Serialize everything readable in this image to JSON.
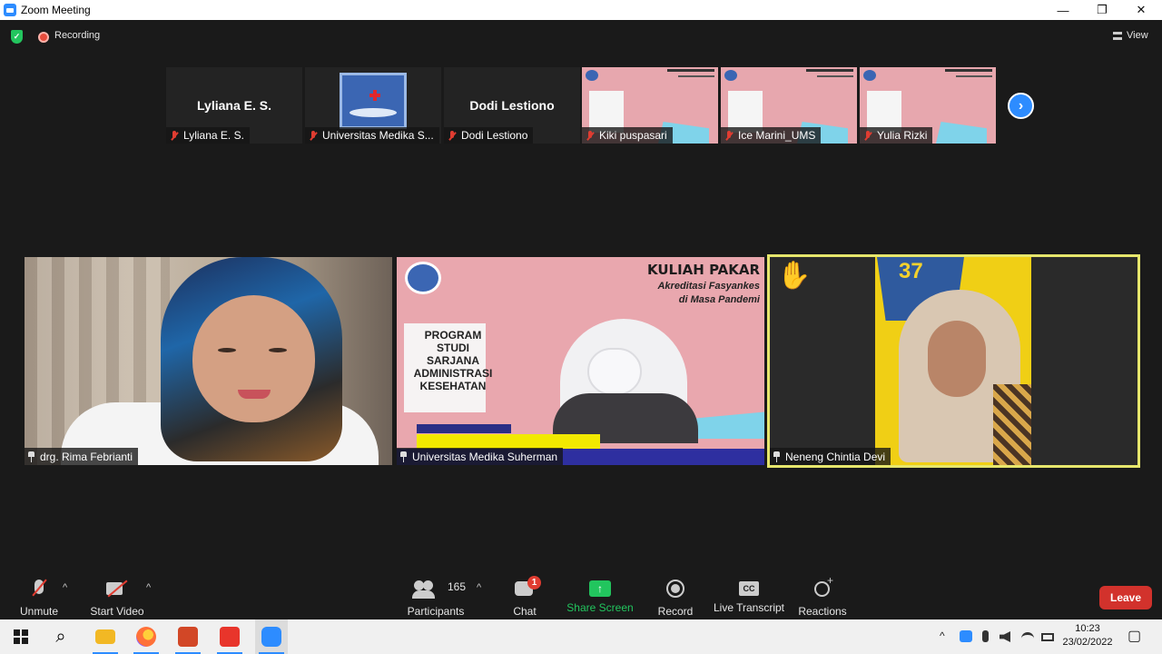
{
  "window": {
    "title": "Zoom Meeting",
    "minimize": "—",
    "restore": "❐",
    "close": "✕"
  },
  "topbar": {
    "security_mark": "✓",
    "recording_label": "Recording",
    "view_label": "View"
  },
  "thumbnails": [
    {
      "display_name": "Lyliana E. S.",
      "label": "Lyliana E. S.",
      "muted": true,
      "content": "name"
    },
    {
      "display_name": "",
      "label": "Universitas Medika S...",
      "muted": true,
      "content": "logo"
    },
    {
      "display_name": "Dodi Lestiono",
      "label": "Dodi Lestiono",
      "muted": true,
      "content": "name"
    },
    {
      "display_name": "",
      "label": "Kiki puspasari",
      "muted": true,
      "content": "slide"
    },
    {
      "display_name": "",
      "label": "Ice Marini_UMS",
      "muted": true,
      "content": "slide"
    },
    {
      "display_name": "",
      "label": "Yulia Rizki",
      "muted": true,
      "content": "slide"
    }
  ],
  "next_page": "›",
  "tiles": [
    {
      "label": "drg. Rima Febrianti"
    },
    {
      "label": "Universitas Medika Suherman",
      "slide_title": "KULIAH PAKAR",
      "slide_subtitle_1": "Akreditasi Fasyankes",
      "slide_subtitle_2": "di Masa Pandemi",
      "program_lines": [
        "PROGRAM",
        "STUDI",
        "SARJANA",
        "ADMINISTRASI",
        "KESEHATAN"
      ]
    },
    {
      "label": "Neneng Chintia Devi",
      "hand_raised": "✋",
      "badge_text": "37"
    }
  ],
  "toolbar": {
    "unmute": "Unmute",
    "start_video": "Start Video",
    "participants": "Participants",
    "participants_count": "165",
    "chat": "Chat",
    "chat_badge": "1",
    "share_screen": "Share Screen",
    "share_arrow": "↑",
    "record": "Record",
    "live_transcript": "Live Transcript",
    "cc": "CC",
    "reactions": "Reactions",
    "leave": "Leave",
    "caret": "^"
  },
  "taskbar": {
    "search_glyph": "⌕",
    "time": "10:23",
    "date": "23/02/2022",
    "tray_caret": "^",
    "notification_glyph": "▢"
  },
  "colors": {
    "accent": "#2d8cff",
    "recording": "#e74c3c",
    "share_green": "#22c55e",
    "leave_red": "#d2322c",
    "active_speaker": "#e6e66c"
  }
}
